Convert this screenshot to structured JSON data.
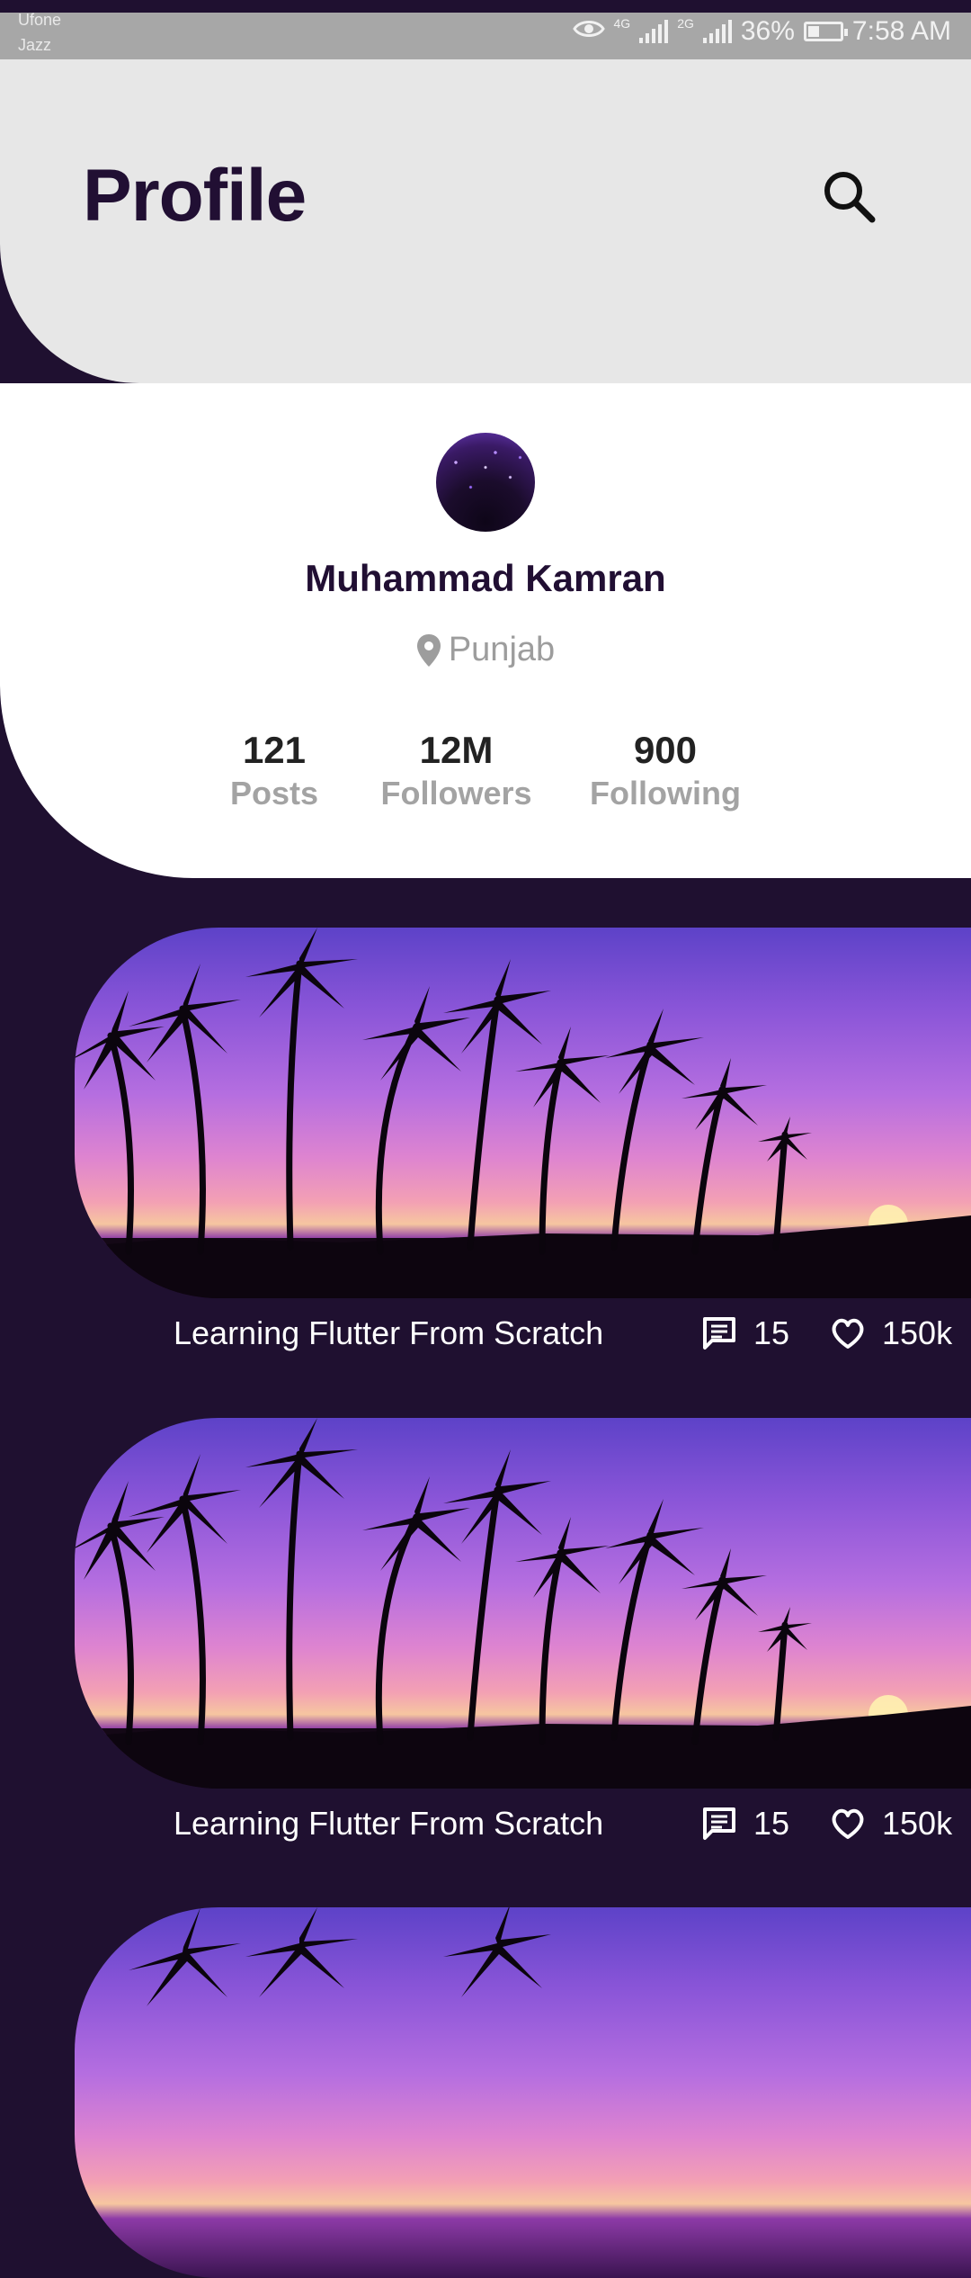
{
  "status_bar": {
    "carrier_1": "Ufone",
    "carrier_2": "Jazz",
    "network_1": "4G",
    "network_2": "2G",
    "battery": "36%",
    "time": "7:58 AM"
  },
  "header": {
    "title": "Profile",
    "search_icon": "search-icon"
  },
  "profile": {
    "name": "Muhammad Kamran",
    "location": "Punjab",
    "stats": [
      {
        "value": "121",
        "label": "Posts"
      },
      {
        "value": "12M",
        "label": "Followers"
      },
      {
        "value": "900",
        "label": "Following"
      }
    ]
  },
  "posts": [
    {
      "title": "Learning Flutter From Scratch",
      "comments": "15",
      "likes": "150k"
    },
    {
      "title": "Learning Flutter From Scratch",
      "comments": "15",
      "likes": "150k"
    },
    {
      "title": "",
      "comments": "",
      "likes": ""
    }
  ],
  "colors": {
    "accent_dark": "#210f33",
    "background": "#1f1030",
    "header_bg": "#e7e7e7",
    "muted_text": "#9d9d9d"
  }
}
